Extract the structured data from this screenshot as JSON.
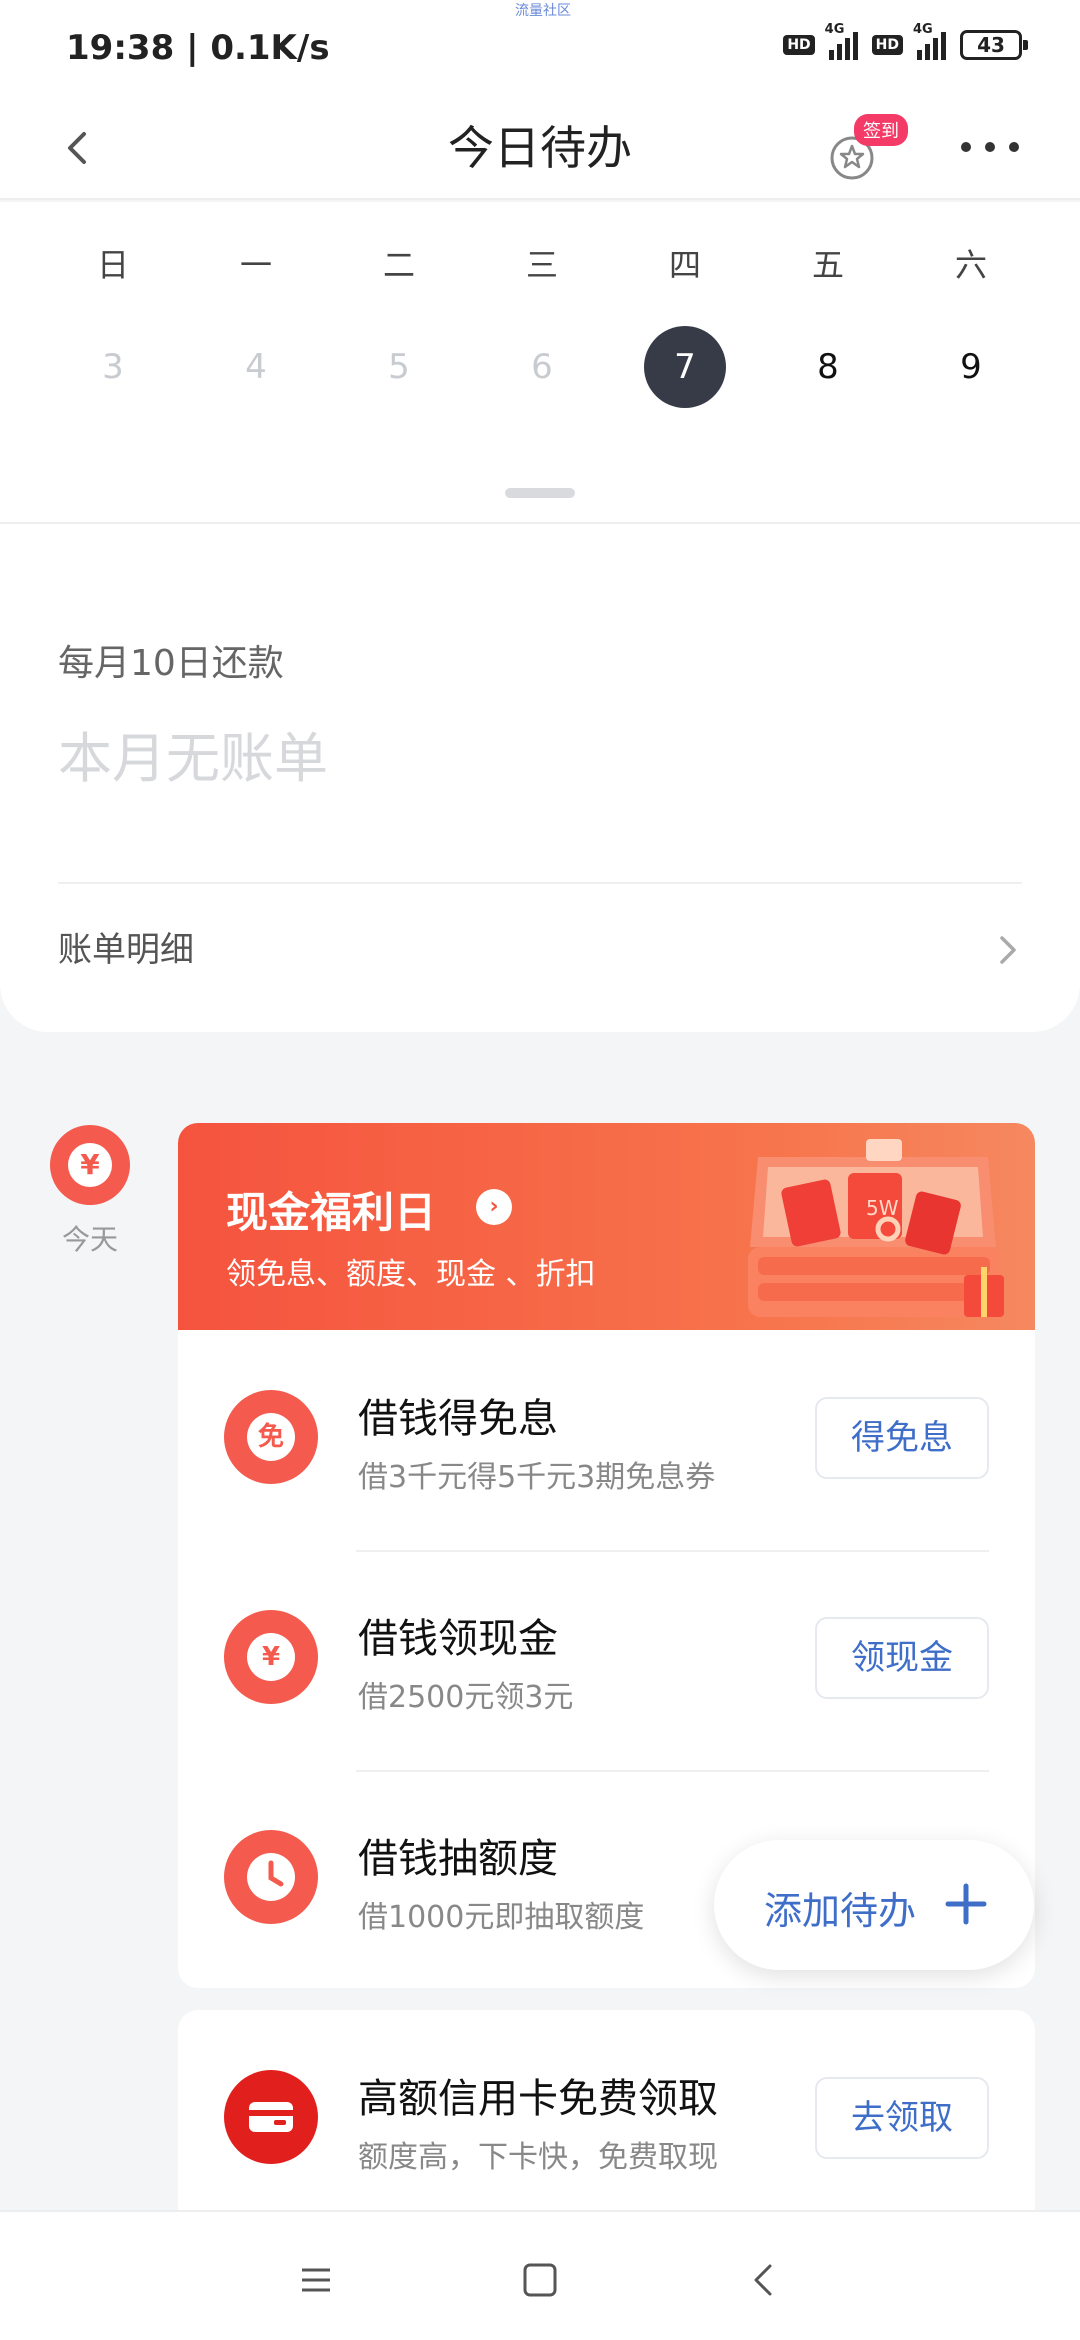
{
  "status_bar": {
    "time": "19:38 | 0.1K/s",
    "tiny_text": "流量社区",
    "hd": "HD",
    "network": "4G",
    "battery": "43"
  },
  "header": {
    "title": "今日待办",
    "signin_badge": "签到"
  },
  "calendar": {
    "weekdays": [
      "日",
      "一",
      "二",
      "三",
      "四",
      "五",
      "六"
    ],
    "dates": [
      "3",
      "4",
      "5",
      "6",
      "7",
      "8",
      "9"
    ],
    "today_index": 4
  },
  "bill": {
    "label": "每月10日还款",
    "status": "本月无账单",
    "detail_link": "账单明细"
  },
  "timeline": {
    "label": "今天",
    "icon": "¥"
  },
  "banner": {
    "title": "现金福利日",
    "subtitle": "领免息、额度、现金 、折扣",
    "art_text": "5W"
  },
  "tasks": [
    {
      "icon_text": "免",
      "title": "借钱得免息",
      "subtitle": "借3千元得5千元3期免息券",
      "button": "得免息"
    },
    {
      "icon_text": "¥",
      "title": "借钱领现金",
      "subtitle": "借2500元领3元",
      "button": "领现金"
    },
    {
      "icon_text": "",
      "title": "借钱抽额度",
      "subtitle": "借1000元即抽取额度",
      "button": ""
    }
  ],
  "card2": {
    "title": "高额信用卡免费领取",
    "subtitle": "额度高，下卡快，免费取现",
    "button": "去领取"
  },
  "fab": {
    "label": "添加待办"
  },
  "colors": {
    "accent": "#f45a4d",
    "link": "#3f6ec9",
    "today": "#363b47",
    "badge": "#f43b67"
  }
}
